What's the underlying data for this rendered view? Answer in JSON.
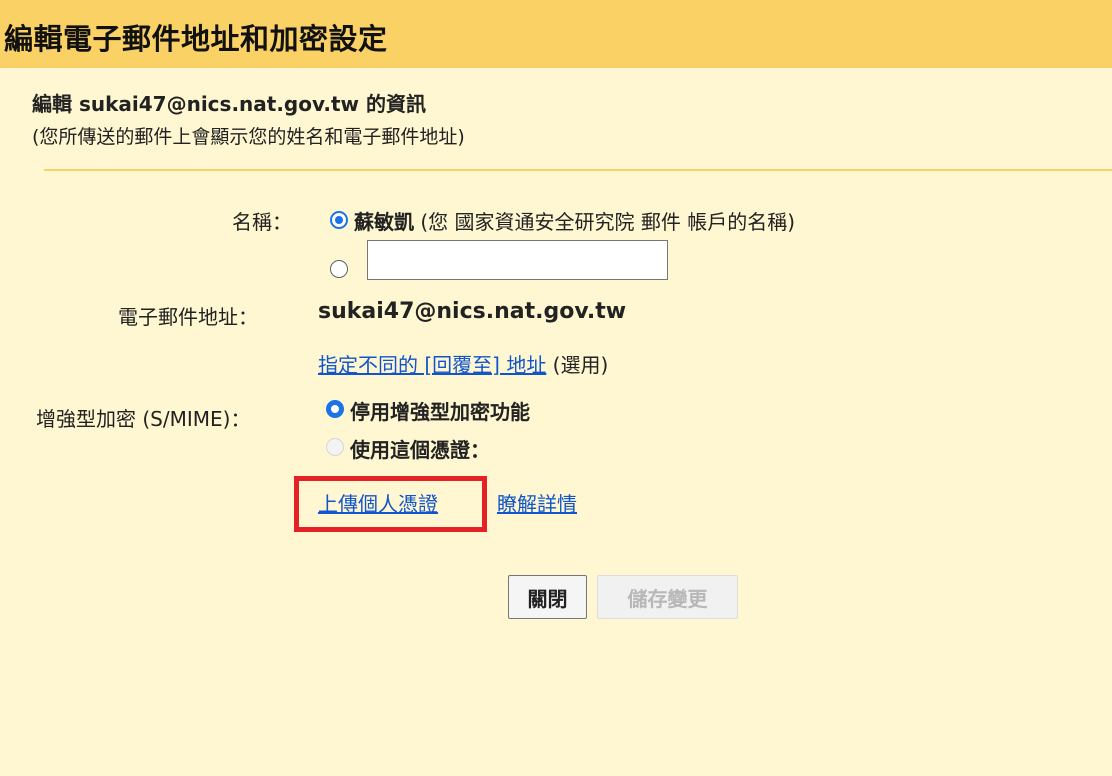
{
  "dialog": {
    "title": "編輯電子郵件地址和加密設定"
  },
  "info": {
    "heading": "編輯 sukai47@nics.nat.gov.tw 的資訊",
    "subheading": "(您所傳送的郵件上會顯示您的姓名和電子郵件地址)"
  },
  "name_field": {
    "label": "名稱：",
    "option1_name": "蘇敏凱",
    "option1_hint": " (您 國家資通安全研究院 郵件 帳戶的名稱)",
    "option2_value": "",
    "option2_placeholder": ""
  },
  "email_field": {
    "label": "電子郵件地址：",
    "value": "sukai47@nics.nat.gov.tw",
    "reply_to_link": "指定不同的 [回覆至] 地址",
    "reply_to_suffix": " (選用)"
  },
  "encryption": {
    "label": "增強型加密 (S/MIME)：",
    "option_disable": "停用增強型加密功能",
    "option_use_cert": "使用這個憑證：",
    "upload_link": "上傳個人憑證",
    "learn_more_link": "瞭解詳情"
  },
  "buttons": {
    "close": "關閉",
    "save": "儲存變更"
  },
  "colors": {
    "header_bg": "#fad165",
    "body_bg": "#fff7d1",
    "link": "#1155cc",
    "radio_accent": "#1a73e8",
    "highlight_border": "#e32227"
  }
}
